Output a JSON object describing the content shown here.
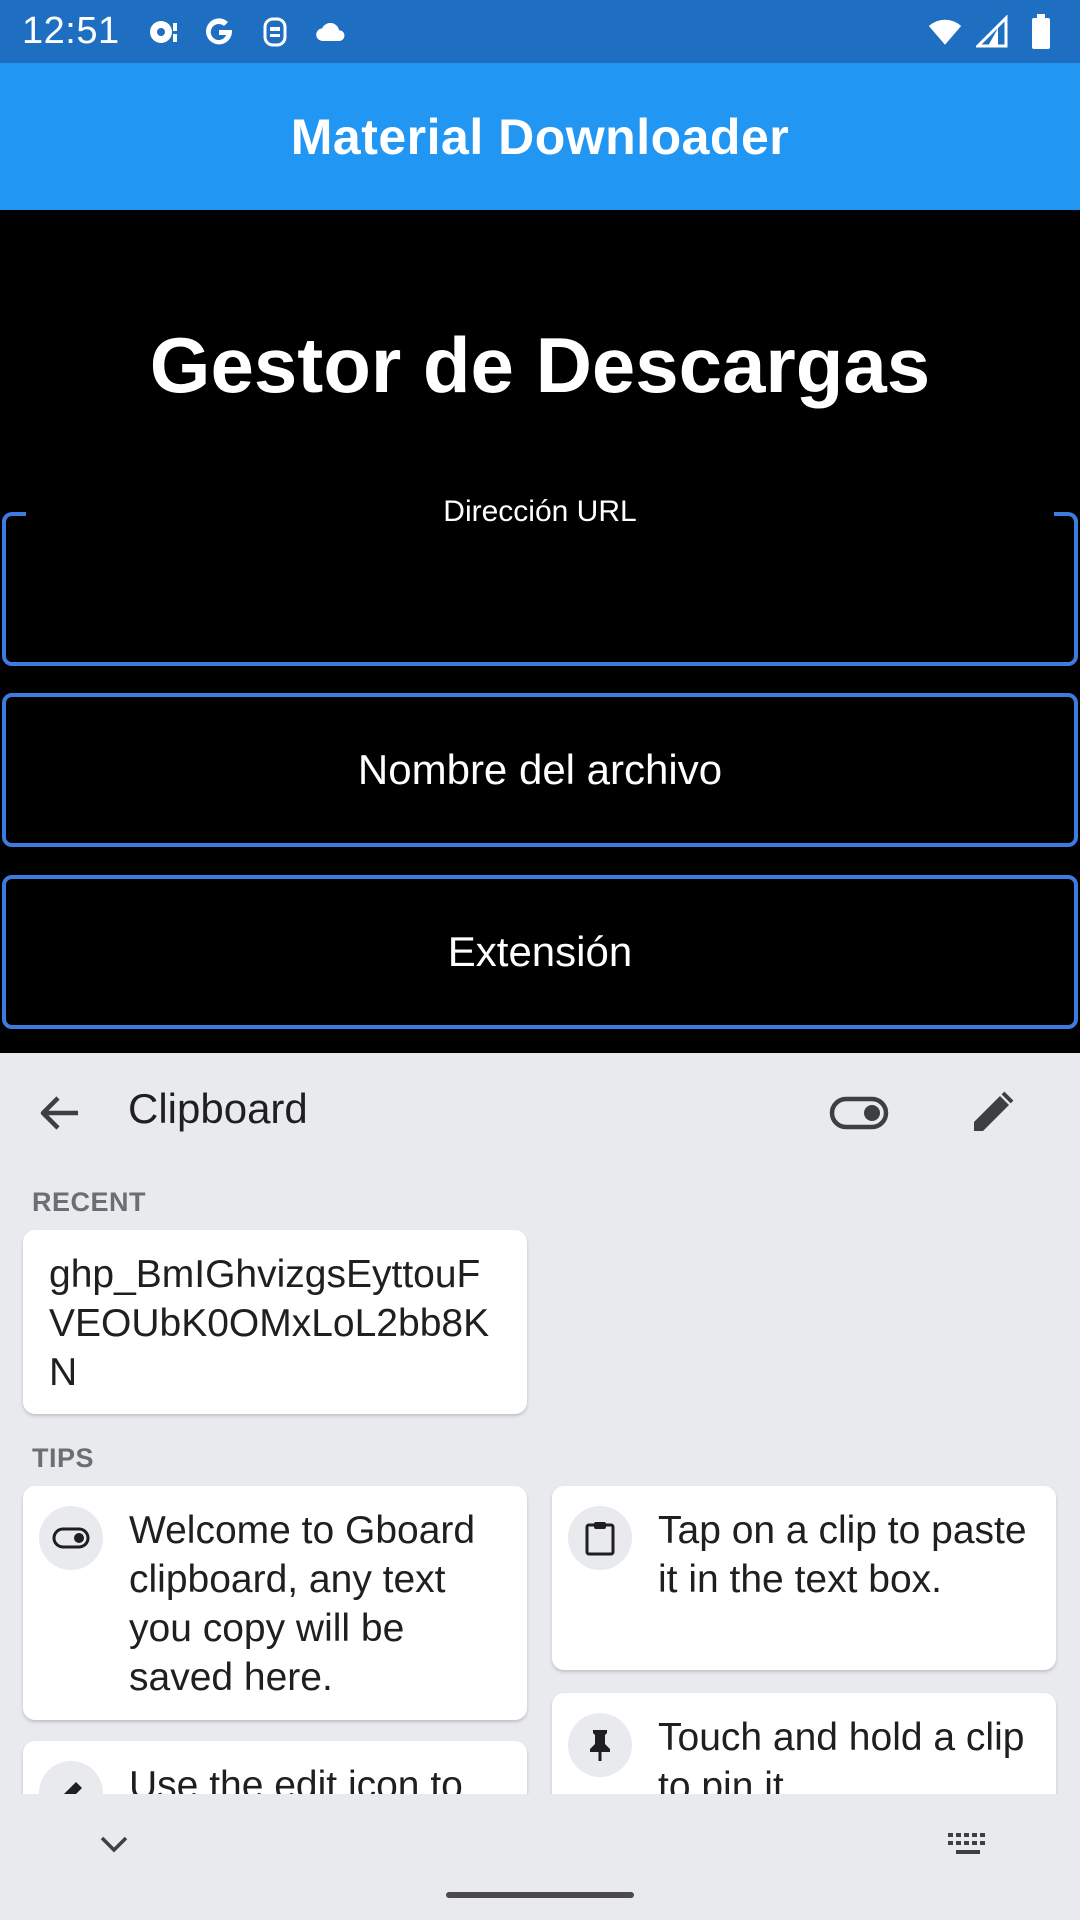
{
  "status_bar": {
    "time": "12:51",
    "left_icons": [
      "podcast-icon",
      "google-icon",
      "assistant-icon",
      "cloud-icon"
    ],
    "right_icons": [
      "wifi-icon",
      "signal-icon",
      "battery-icon"
    ]
  },
  "app_bar": {
    "title": "Material Downloader",
    "color": "#2196f3"
  },
  "main": {
    "heading": "Gestor de Descargas",
    "fields": {
      "url_label": "Dirección URL",
      "url_value": "",
      "name_label": "Nombre del archivo",
      "ext_label": "Extensión"
    },
    "accent": "#3d7be0"
  },
  "clipboard": {
    "title": "Clipboard",
    "recent_label": "RECENT",
    "recent_items": [
      "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"
    ],
    "tips_label": "TIPS",
    "tips": [
      {
        "icon": "toggle-icon",
        "text": "Welcome to Gboard clipboard, any text you copy will be saved here."
      },
      {
        "icon": "clipboard-icon",
        "text": "Tap on a clip to paste it in the text box."
      },
      {
        "icon": "edit-icon",
        "text": "Use the edit icon to"
      },
      {
        "icon": "pin-icon",
        "text": "Touch and hold a clip to pin it"
      }
    ]
  }
}
